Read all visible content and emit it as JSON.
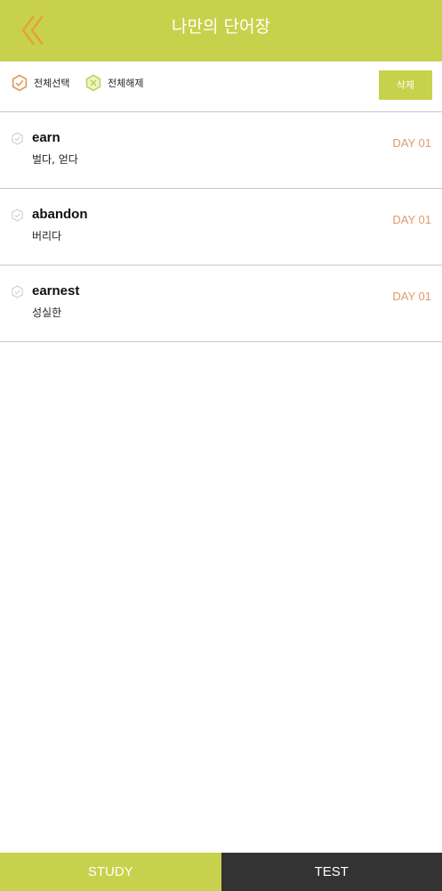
{
  "colors": {
    "accent": "#c8d14b",
    "back_arrow": "#e3a23c",
    "select_all_icon": "#d99a5a",
    "deselect_all_icon": "#b9d65a",
    "day_text": "#e09a6b",
    "test_tab": "#333333",
    "divider": "#c8c8c8"
  },
  "header": {
    "title": "나만의 단어장",
    "back_icon": "double-chevron-left-icon"
  },
  "toolbar": {
    "select_all_label": "전체선택",
    "select_all_icon": "hexagon-check-icon",
    "deselect_all_label": "전체해제",
    "deselect_all_icon": "hexagon-x-icon",
    "delete_label": "삭제"
  },
  "words": [
    {
      "term": "earn",
      "meaning": "벌다, 얻다",
      "day": "DAY 01",
      "checked": false
    },
    {
      "term": "abandon",
      "meaning": "버리다",
      "day": "DAY 01",
      "checked": false
    },
    {
      "term": "earnest",
      "meaning": "성실한",
      "day": "DAY 01",
      "checked": false
    }
  ],
  "bottom_nav": {
    "study_label": "STUDY",
    "test_label": "TEST",
    "active": "STUDY"
  }
}
